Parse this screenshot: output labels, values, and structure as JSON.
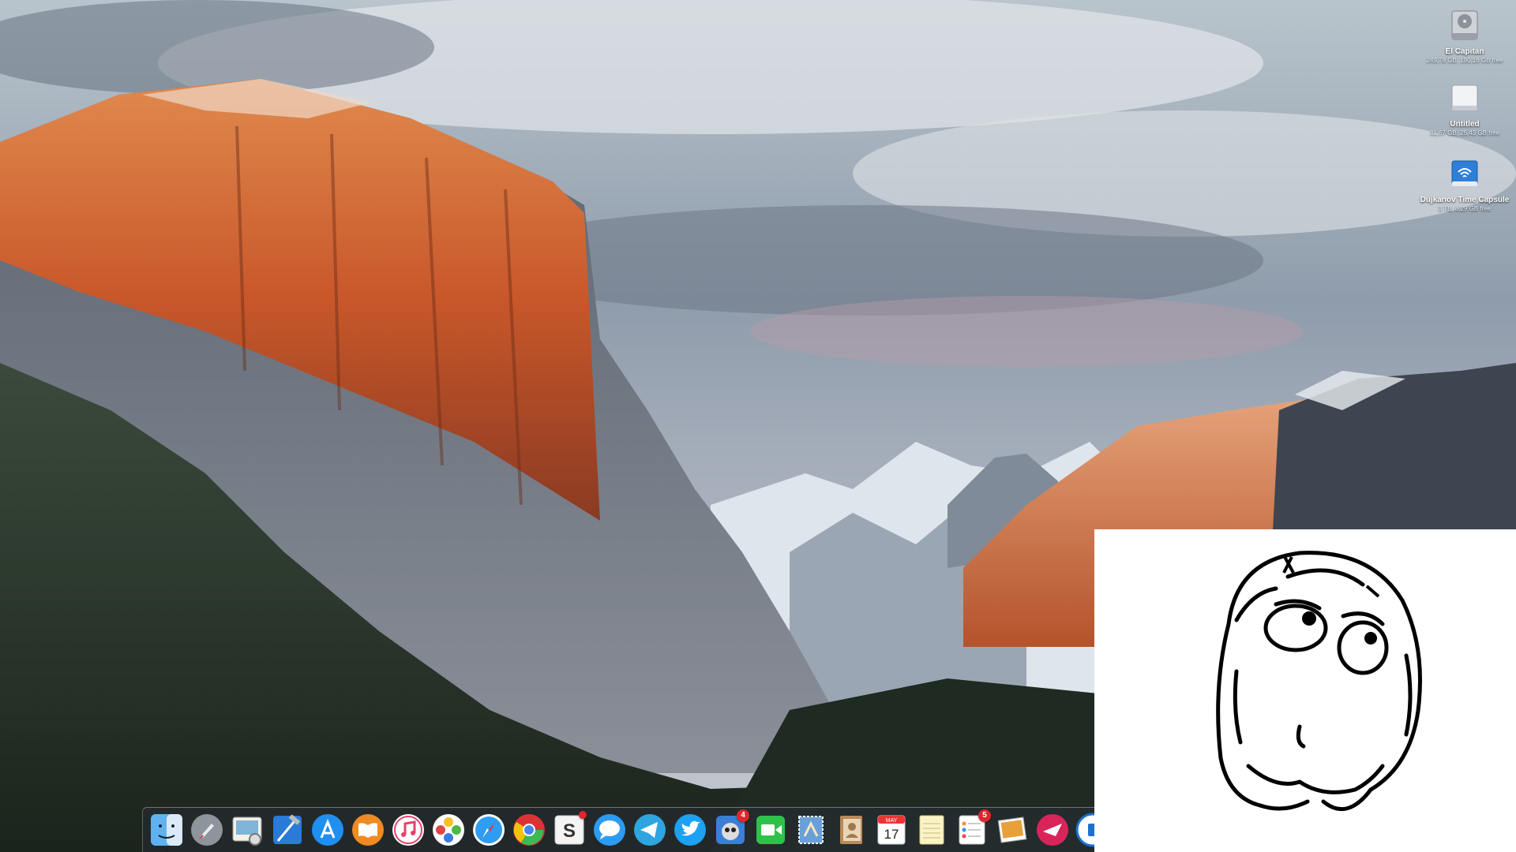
{
  "desktop": {
    "wallpaper": "el-capitan-landscape",
    "icons": [
      {
        "name": "El Capitan",
        "info": "249,78 GB, 190,16 GB free",
        "icon": "internal-disk-icon"
      },
      {
        "name": "Untitled",
        "info": "31,67 GB, 25,43 GB free",
        "icon": "external-disk-icon"
      },
      {
        "name": "Dujkanov Time Capsule",
        "info": "3 TB, 8,29 GB free",
        "icon": "time-capsule-icon"
      }
    ]
  },
  "dock": {
    "items": [
      {
        "app": "finder",
        "icon": "finder-icon",
        "running": true
      },
      {
        "app": "launchpad",
        "icon": "launchpad-rocket-icon"
      },
      {
        "app": "preview",
        "icon": "preview-icon"
      },
      {
        "app": "xcode",
        "icon": "xcode-hammer-icon"
      },
      {
        "app": "app-store",
        "icon": "app-store-icon"
      },
      {
        "app": "ibooks",
        "icon": "ibooks-icon"
      },
      {
        "app": "itunes",
        "icon": "itunes-note-icon"
      },
      {
        "app": "photos",
        "icon": "photos-flower-icon"
      },
      {
        "app": "safari",
        "icon": "safari-compass-icon"
      },
      {
        "app": "chrome",
        "icon": "chrome-icon"
      },
      {
        "app": "skype",
        "icon": "skype-icon",
        "badge": ""
      },
      {
        "app": "messages",
        "icon": "messages-bubble-icon"
      },
      {
        "app": "telegram",
        "icon": "telegram-plane-icon"
      },
      {
        "app": "twitter",
        "icon": "twitter-bird-icon"
      },
      {
        "app": "tweetbot",
        "icon": "tweetbot-icon",
        "badge": "4",
        "running": true
      },
      {
        "app": "facetime",
        "icon": "facetime-camera-icon"
      },
      {
        "app": "mail",
        "icon": "mail-stamp-icon"
      },
      {
        "app": "contacts",
        "icon": "contacts-book-icon"
      },
      {
        "app": "calendar",
        "icon": "calendar-icon",
        "month": "MAY",
        "day": "17"
      },
      {
        "app": "notes",
        "icon": "notes-pad-icon"
      },
      {
        "app": "reminders",
        "icon": "reminders-list-icon",
        "badge": "5"
      },
      {
        "app": "iphoto",
        "icon": "iphoto-icon"
      },
      {
        "app": "airmail",
        "icon": "airmail-icon"
      },
      {
        "app": "unknown",
        "icon": "app-icon"
      }
    ]
  },
  "overlay": {
    "meme": "thinking-rage-face"
  }
}
